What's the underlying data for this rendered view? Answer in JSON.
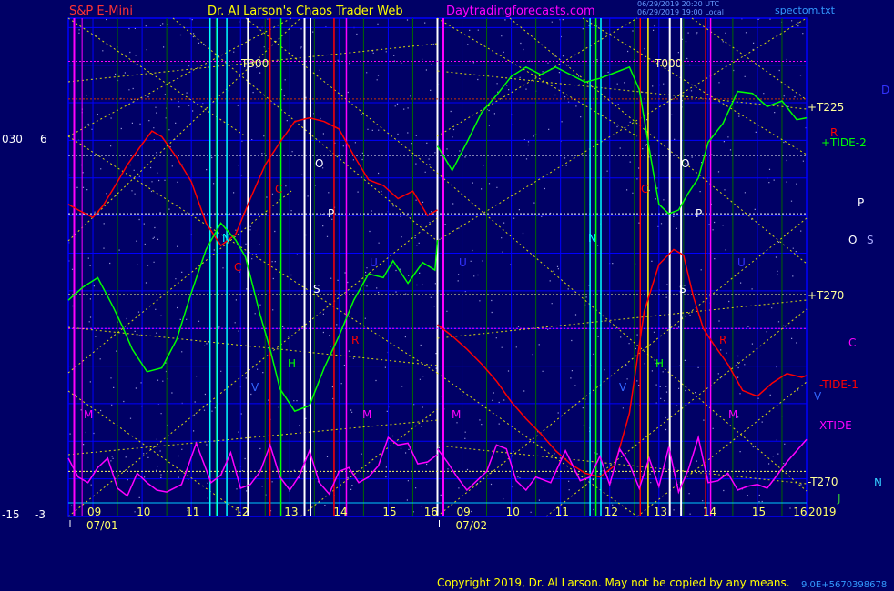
{
  "header": {
    "symbol": "S&P E-Mini",
    "author": "Dr. Al Larson's Chaos Trader Web",
    "site": "Daytradingforecasts.com",
    "stamp1": "06/29/2019 20:20 UTC",
    "stamp2": "06/29/2019 19:00 Local",
    "file": "spectom.txt"
  },
  "left_axis": {
    "top_a": "030",
    "top_b": "6",
    "bottom_a": "-15",
    "bottom_b": "-3"
  },
  "footer": {
    "copyright": "Copyright 2019, Dr. Al Larson. May not be copied by any means.",
    "code": "9.0E+5670398678"
  },
  "colors": {
    "background": "#000066",
    "grid_blue": "#0000ff",
    "grid_green": "#006600",
    "red": "#ff0000",
    "green": "#00ff00",
    "magenta": "#ff00ff",
    "yellow": "#ffff00",
    "cyan": "#00ffff",
    "white": "#ffffff"
  },
  "chart_data": {
    "type": "line",
    "title": "S&P E-Mini",
    "x_axis": {
      "day_labels": [
        "07/01",
        "07/02"
      ],
      "hour_ticks": [
        "09",
        "10",
        "11",
        "12",
        "13",
        "14",
        "15",
        "16",
        "09",
        "10",
        "11",
        "12",
        "13",
        "14",
        "15",
        "16"
      ],
      "end_label": "2019"
    },
    "grid": true,
    "series": [
      {
        "name": "TIDE-1",
        "color": "#ff0000",
        "x": [
          8.5,
          8.7,
          9.0,
          9.2,
          9.5,
          9.7,
          10.0,
          10.2,
          10.4,
          10.7,
          11.0,
          11.3,
          11.6,
          11.9,
          12.2,
          12.5,
          12.8,
          13.1,
          13.4,
          13.7,
          14.0,
          14.3,
          14.6,
          14.9,
          15.2,
          15.5,
          15.8,
          16.0,
          8.5,
          8.8,
          9.1,
          9.4,
          9.7,
          10.0,
          10.3,
          10.6,
          10.9,
          11.2,
          11.5,
          11.8,
          12.1,
          12.4,
          12.7,
          13.0,
          13.3,
          13.5,
          13.7,
          13.9,
          14.1,
          14.4,
          14.7,
          15.0,
          15.3,
          15.6,
          15.9,
          16.0
        ],
        "y": [
          0.6,
          0.3,
          -0.1,
          0.5,
          1.8,
          2.7,
          3.8,
          4.5,
          4.2,
          3.1,
          1.8,
          -0.4,
          -1.6,
          -1.0,
          0.9,
          2.7,
          3.9,
          5.0,
          5.2,
          5.0,
          4.6,
          3.2,
          1.9,
          1.6,
          0.9,
          1.3,
          0.0,
          0.3,
          -5.8,
          -6.4,
          -7.1,
          -7.9,
          -8.8,
          -9.9,
          -10.8,
          -11.6,
          -12.5,
          -13.2,
          -13.7,
          -13.9,
          -13.3,
          -10.5,
          -5.1,
          -2.6,
          -1.8,
          -2.1,
          -4.3,
          -6.0,
          -6.8,
          -7.9,
          -9.3,
          -9.6,
          -8.9,
          -8.4,
          -8.6,
          -8.5
        ]
      },
      {
        "name": "TIDE-2",
        "color": "#00ff00",
        "x": [
          8.5,
          8.8,
          9.1,
          9.4,
          9.6,
          9.8,
          10.1,
          10.4,
          10.7,
          11.0,
          11.3,
          11.6,
          11.9,
          12.1,
          12.4,
          12.6,
          12.8,
          13.1,
          13.4,
          13.7,
          14.0,
          14.3,
          14.6,
          14.9,
          15.1,
          15.4,
          15.7,
          15.95,
          16.0,
          8.5,
          8.8,
          9.1,
          9.4,
          9.7,
          10.0,
          10.3,
          10.6,
          10.9,
          11.2,
          11.5,
          11.8,
          12.1,
          12.4,
          12.6,
          12.8,
          13.0,
          13.2,
          13.4,
          13.6,
          13.8,
          14.0,
          14.3,
          14.6,
          14.9,
          15.2,
          15.5,
          15.8,
          16.0
        ],
        "y": [
          -4.5,
          -3.8,
          -3.3,
          -4.8,
          -5.9,
          -7.1,
          -8.3,
          -8.1,
          -6.6,
          -4.1,
          -1.8,
          -0.4,
          -1.3,
          -2.2,
          -5.3,
          -7.1,
          -9.2,
          -10.4,
          -10.1,
          -8.1,
          -6.4,
          -4.5,
          -3.1,
          -3.3,
          -2.4,
          -3.6,
          -2.5,
          -2.9,
          -1.3,
          3.7,
          2.4,
          3.9,
          5.5,
          6.4,
          7.4,
          7.9,
          7.5,
          7.9,
          7.5,
          7.1,
          7.3,
          7.6,
          7.9,
          6.7,
          3.6,
          0.6,
          0.1,
          0.3,
          1.2,
          2.0,
          3.9,
          4.9,
          6.6,
          6.5,
          5.8,
          6.1,
          5.1,
          5.2
        ]
      },
      {
        "name": "XTIDE",
        "color": "#ff00ff",
        "x": [
          8.5,
          8.7,
          8.9,
          9.1,
          9.3,
          9.5,
          9.7,
          9.9,
          10.1,
          10.3,
          10.5,
          10.8,
          11.1,
          11.4,
          11.6,
          11.8,
          12.0,
          12.2,
          12.4,
          12.6,
          12.8,
          13.0,
          13.2,
          13.4,
          13.6,
          13.8,
          14.0,
          14.2,
          14.4,
          14.6,
          14.8,
          15.0,
          15.2,
          15.4,
          15.6,
          15.8,
          16.0,
          8.5,
          8.7,
          8.9,
          9.1,
          9.3,
          9.5,
          9.7,
          9.9,
          10.1,
          10.3,
          10.5,
          10.8,
          11.1,
          11.4,
          11.6,
          11.8,
          12.0,
          12.2,
          12.4,
          12.6,
          12.8,
          13.0,
          13.2,
          13.4,
          13.6,
          13.8,
          14.0,
          14.2,
          14.4,
          14.6,
          14.8,
          15.0,
          15.2,
          15.4,
          15.6,
          15.8,
          16.0
        ],
        "y": [
          -12.9,
          -13.9,
          -14.2,
          -13.4,
          -12.9,
          -14.5,
          -14.9,
          -13.7,
          -14.2,
          -14.6,
          -14.7,
          -14.3,
          -12.1,
          -14.2,
          -13.8,
          -12.6,
          -14.5,
          -14.3,
          -13.6,
          -12.2,
          -13.9,
          -14.6,
          -13.8,
          -12.5,
          -14.2,
          -14.8,
          -13.6,
          -13.4,
          -14.2,
          -13.9,
          -13.3,
          -11.8,
          -12.2,
          -12.1,
          -13.2,
          -13.1,
          -12.7,
          -12.4,
          -13.1,
          -13.9,
          -14.6,
          -14.1,
          -13.6,
          -12.2,
          -12.4,
          -14.1,
          -14.6,
          -13.9,
          -14.2,
          -12.5,
          -14.1,
          -13.9,
          -12.8,
          -14.3,
          -12.4,
          -13.2,
          -14.5,
          -12.9,
          -14.4,
          -12.3,
          -14.7,
          -13.5,
          -11.8,
          -14.2,
          -14.1,
          -13.7,
          -14.6,
          -14.4,
          -14.3,
          -14.5,
          -13.8,
          -13.1,
          -12.5,
          -11.9
        ]
      }
    ],
    "level_labels": [
      "T300",
      "T000",
      "+T225",
      "+T270",
      "-T270"
    ],
    "series_labels": [
      "+TIDE-2",
      "-TIDE-1",
      "XTIDE"
    ],
    "letter_labels": [
      "M",
      "R",
      "P",
      "O",
      "S",
      "C",
      "V",
      "N",
      "J",
      "H",
      "D",
      "U"
    ]
  }
}
